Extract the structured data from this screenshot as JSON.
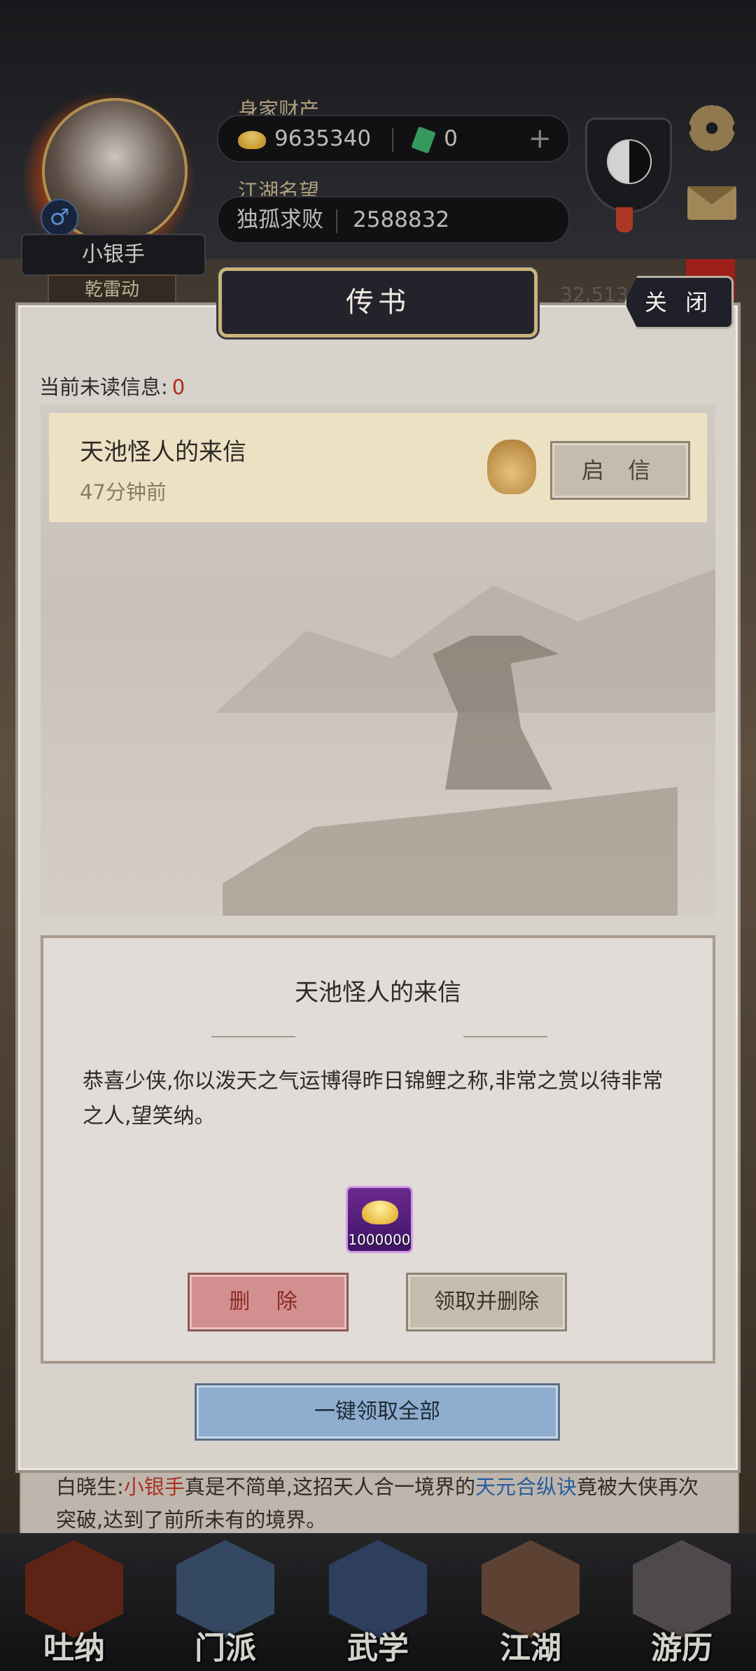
{
  "player": {
    "name": "小银手",
    "skill": "乾雷动"
  },
  "stats": {
    "wealth_label": "身家财产",
    "gold": "9635340",
    "jade": "0",
    "fame_label": "江湖名望",
    "fame_title": "独孤求败",
    "fame_value": "2588832"
  },
  "background": {
    "number": "32,513",
    "chat": {
      "speaker": "白晓生:",
      "name": "小银手",
      "text1": "真是不简单,这招天人合一境界的",
      "skill": "天元合纵诀",
      "text2": "竟被大侠再次突破,达到了前所未有的境界。"
    }
  },
  "modal": {
    "title": "传书",
    "close_label": "关 闭",
    "unread_label": "当前未读信息:",
    "unread_count": "0",
    "mail_item": {
      "title": "天池怪人的来信",
      "time": "47分钟前",
      "open_label": "启 信"
    },
    "detail": {
      "title": "天池怪人的来信",
      "body": "恭喜少侠,你以泼天之气运博得昨日锦鲤之称,非常之赏以待非常之人,望笑纳。",
      "reward_qty": "1000000",
      "delete_label": "删 除",
      "claim_delete_label": "领取并删除"
    },
    "claim_all_label": "一键领取全部"
  },
  "nav": [
    {
      "label": "吐纳"
    },
    {
      "label": "门派"
    },
    {
      "label": "武学"
    },
    {
      "label": "江湖"
    },
    {
      "label": "游历"
    }
  ]
}
